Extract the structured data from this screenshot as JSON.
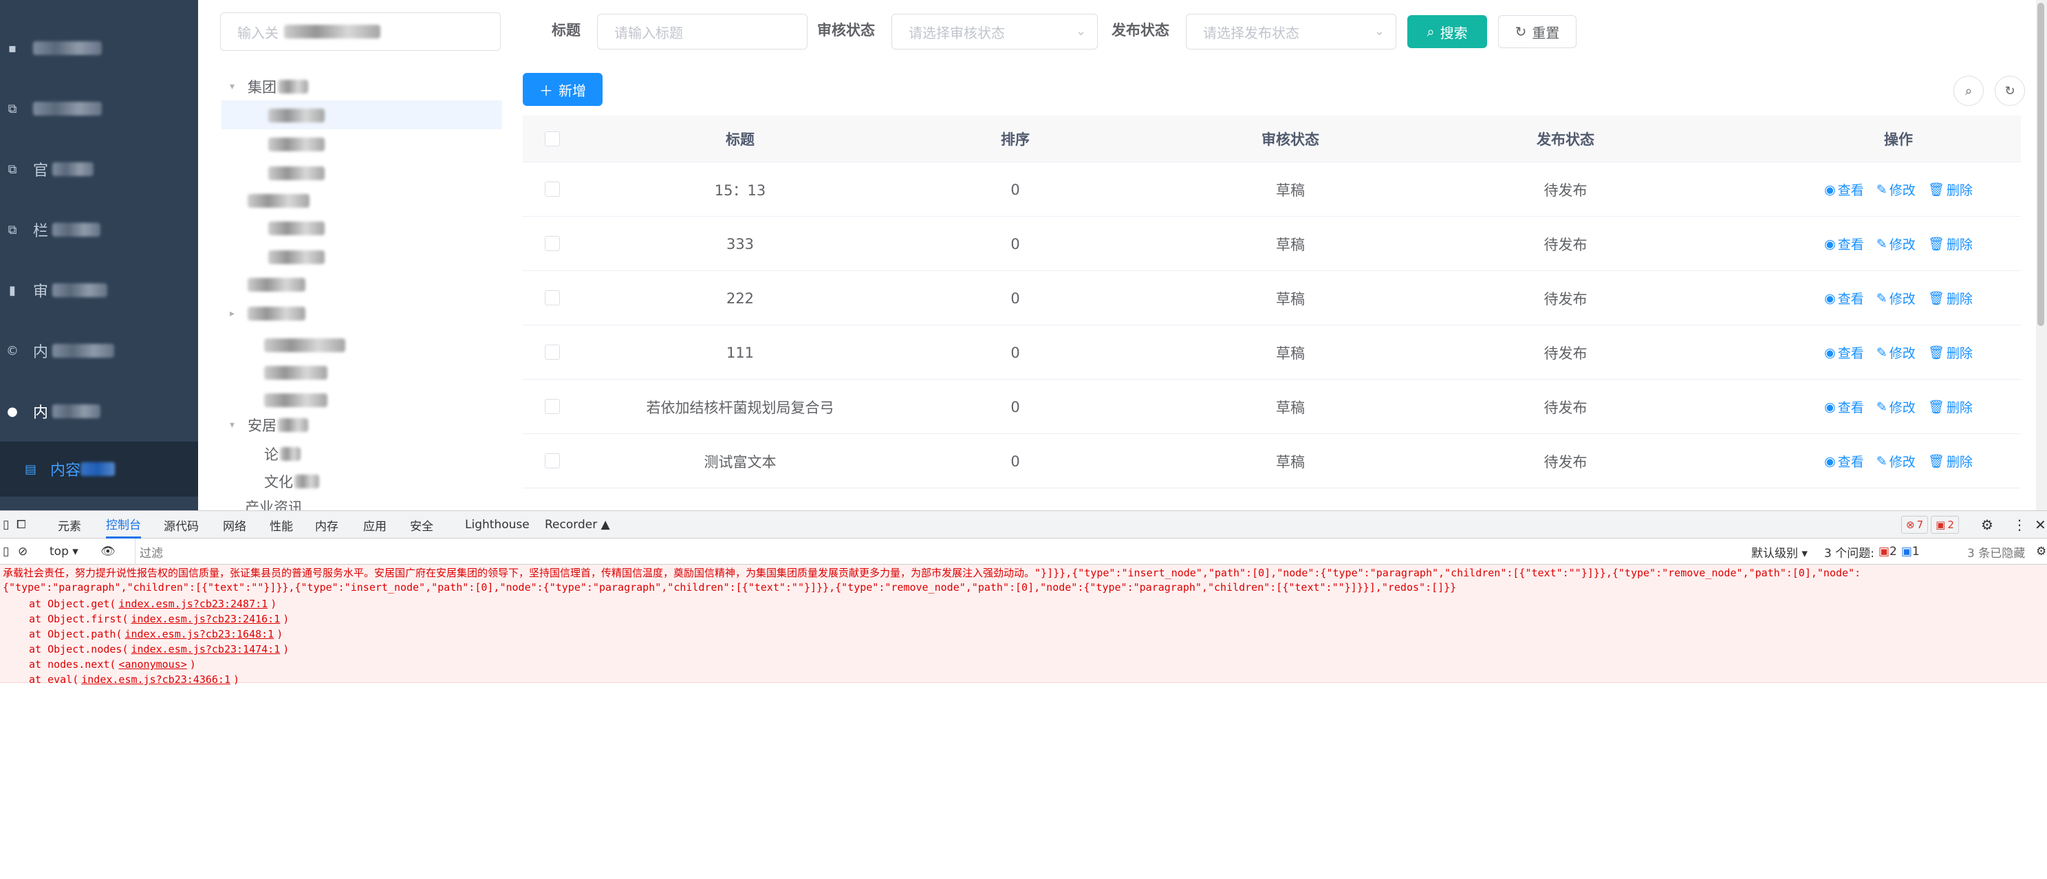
{
  "sidebar": {
    "items": [
      {
        "icon": "menu-icon",
        "label": ""
      },
      {
        "icon": "copy-icon",
        "label": ""
      },
      {
        "icon": "copy-icon",
        "label": "官"
      },
      {
        "icon": "copy-icon",
        "label": "栏"
      },
      {
        "icon": "chart-icon",
        "label": "审"
      },
      {
        "icon": "copyright-icon",
        "label": "内"
      },
      {
        "icon": "user-icon",
        "label": "内"
      }
    ],
    "active_sub": {
      "icon": "document-icon",
      "label": "内容"
    }
  },
  "search": {
    "tree_placeholder": "输入关",
    "title_label": "标题",
    "title_placeholder": "请输入标题",
    "review_label": "审核状态",
    "review_placeholder": "请选择审核状态",
    "publish_label": "发布状态",
    "publish_placeholder": "请选择发布状态",
    "search_button": "搜索",
    "reset_button": "重置"
  },
  "toolbar": {
    "add_button": "新增"
  },
  "tree": {
    "nodes": [
      {
        "label": "集团",
        "expanded": true
      },
      {
        "label": "",
        "expanded": false
      },
      {
        "label": "",
        "expanded": false
      },
      {
        "label": "",
        "expanded": false
      },
      {
        "label": "",
        "expanded": false
      },
      {
        "label": "",
        "expanded": false
      },
      {
        "label": "",
        "expanded": false
      },
      {
        "label": "",
        "expanded": false
      },
      {
        "label": "",
        "expanded": false
      },
      {
        "label": "",
        "expanded": false
      },
      {
        "label": "",
        "expanded": false
      },
      {
        "label": "",
        "expanded": false
      },
      {
        "label": "安居",
        "expanded": true
      },
      {
        "label": "论",
        "expanded": false
      },
      {
        "label": "文化",
        "expanded": false
      },
      {
        "label": "产业资讯",
        "expanded": false
      }
    ]
  },
  "table": {
    "headers": [
      "标题",
      "排序",
      "审核状态",
      "发布状态",
      "操作"
    ],
    "ops": {
      "view": "查看",
      "edit": "修改",
      "delete": "删除"
    },
    "rows": [
      {
        "title": "15：13",
        "order": "0",
        "review": "草稿",
        "publish": "待发布"
      },
      {
        "title": "333",
        "order": "0",
        "review": "草稿",
        "publish": "待发布"
      },
      {
        "title": "222",
        "order": "0",
        "review": "草稿",
        "publish": "待发布"
      },
      {
        "title": "111",
        "order": "0",
        "review": "草稿",
        "publish": "待发布"
      },
      {
        "title": "若依加结核杆菌规划局复合弓",
        "order": "0",
        "review": "草稿",
        "publish": "待发布"
      },
      {
        "title": "测试富文本",
        "order": "0",
        "review": "草稿",
        "publish": "待发布"
      }
    ]
  },
  "devtools": {
    "tabs": [
      "元素",
      "控制台",
      "源代码",
      "网络",
      "性能",
      "内存",
      "应用",
      "安全",
      "Lighthouse",
      "Recorder ▲"
    ],
    "active_tab": "控制台",
    "context": "top",
    "filter": "过滤",
    "level": "默认级别 ▾",
    "issues": "3 个问题:",
    "issues_err": "2",
    "issues_info": "1",
    "hidden": "3 条已隐藏",
    "errors_count": "7",
    "warnings_count": "2",
    "error_lines": [
      "承载社会责任，努力提升说性报告权的国信质量，张证集县员的普通号服务水平。安居国广府在安居集团的领导下，坚持国信理首，传精国信温度，奠励国信精神，为集国集团质量发展贡献更多力量，为部市发展注入强劲动动。\"}]}},{\"type\":\"insert_node\",\"path\":[0],\"node\":{\"type\":\"paragraph\",\"children\":[{\"text\":\"\"}]}},{\"type\":\"remove_node\",\"path\":[0],\"node\":",
      "{\"type\":\"paragraph\",\"children\":[{\"text\":\"\"}]}},{\"type\":\"insert_node\",\"path\":[0],\"node\":{\"type\":\"paragraph\",\"children\":[{\"text\":\"\"}]}},{\"type\":\"remove_node\",\"path\":[0],\"node\":{\"type\":\"paragraph\",\"children\":[{\"text\":\"\"}]}}],\"redos\":[]}}"
    ],
    "stack": [
      {
        "fn": "at Object.get",
        "loc": "index.esm.js?cb23:2487:1"
      },
      {
        "fn": "at Object.first",
        "loc": "index.esm.js?cb23:2416:1"
      },
      {
        "fn": "at Object.path",
        "loc": "index.esm.js?cb23:1648:1"
      },
      {
        "fn": "at Object.nodes",
        "loc": "index.esm.js?cb23:1474:1"
      },
      {
        "fn": "at nodes.next",
        "loc": "<anonymous>"
      },
      {
        "fn": "at eval",
        "loc": "index.esm.js?cb23:4366:1"
      }
    ]
  }
}
